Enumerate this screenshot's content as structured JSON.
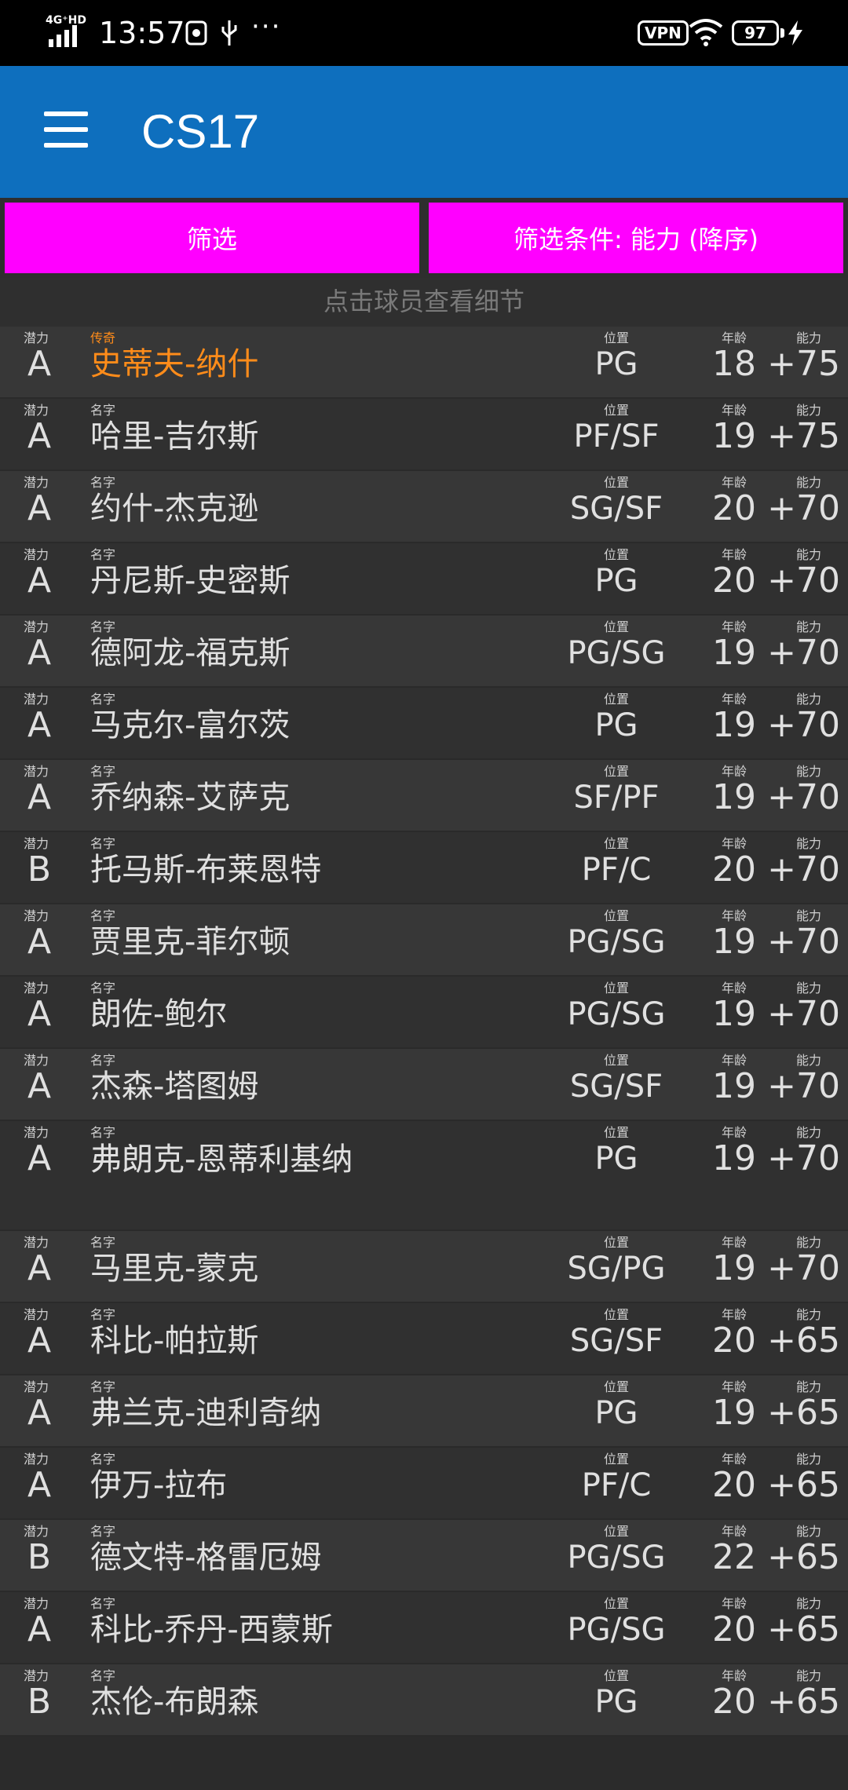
{
  "status_bar": {
    "network": "4G⁺HD",
    "time": "13:57",
    "more": "···",
    "vpn": "VPN",
    "battery": "97"
  },
  "app_bar": {
    "title": "CS17"
  },
  "filters": {
    "filter_label": "筛选",
    "sort_label": "筛选条件: 能力 (降序)"
  },
  "hint": "点击球员查看细节",
  "labels": {
    "potential": "潜力",
    "name": "名字",
    "legend_name": "传奇",
    "position": "位置",
    "age": "年龄",
    "ability": "能力"
  },
  "players": [
    {
      "potential": "A",
      "name": "史蒂夫-纳什",
      "position": "PG",
      "age": "18",
      "ability": "+75",
      "legend": true
    },
    {
      "potential": "A",
      "name": "哈里-吉尔斯",
      "position": "PF/SF",
      "age": "19",
      "ability": "+75"
    },
    {
      "potential": "A",
      "name": "约什-杰克逊",
      "position": "SG/SF",
      "age": "20",
      "ability": "+70"
    },
    {
      "potential": "A",
      "name": "丹尼斯-史密斯",
      "position": "PG",
      "age": "20",
      "ability": "+70"
    },
    {
      "potential": "A",
      "name": "德阿龙-福克斯",
      "position": "PG/SG",
      "age": "19",
      "ability": "+70"
    },
    {
      "potential": "A",
      "name": "马克尔-富尔茨",
      "position": "PG",
      "age": "19",
      "ability": "+70"
    },
    {
      "potential": "A",
      "name": "乔纳森-艾萨克",
      "position": "SF/PF",
      "age": "19",
      "ability": "+70"
    },
    {
      "potential": "B",
      "name": "托马斯-布莱恩特",
      "position": "PF/C",
      "age": "20",
      "ability": "+70"
    },
    {
      "potential": "A",
      "name": "贾里克-菲尔顿",
      "position": "PG/SG",
      "age": "19",
      "ability": "+70"
    },
    {
      "potential": "A",
      "name": "朗佐-鲍尔",
      "position": "PG/SG",
      "age": "19",
      "ability": "+70"
    },
    {
      "potential": "A",
      "name": "杰森-塔图姆",
      "position": "SG/SF",
      "age": "19",
      "ability": "+70"
    },
    {
      "potential": "A",
      "name": "弗朗克-恩蒂利基纳",
      "position": "PG",
      "age": "19",
      "ability": "+70",
      "tall": true
    },
    {
      "potential": "A",
      "name": "马里克-蒙克",
      "position": "SG/PG",
      "age": "19",
      "ability": "+70"
    },
    {
      "potential": "A",
      "name": "科比-帕拉斯",
      "position": "SG/SF",
      "age": "20",
      "ability": "+65"
    },
    {
      "potential": "A",
      "name": "弗兰克-迪利奇纳",
      "position": "PG",
      "age": "19",
      "ability": "+65"
    },
    {
      "potential": "A",
      "name": "伊万-拉布",
      "position": "PF/C",
      "age": "20",
      "ability": "+65"
    },
    {
      "potential": "B",
      "name": "德文特-格雷厄姆",
      "position": "PG/SG",
      "age": "22",
      "ability": "+65"
    },
    {
      "potential": "A",
      "name": "科比-乔丹-西蒙斯",
      "position": "PG/SG",
      "age": "20",
      "ability": "+65"
    },
    {
      "potential": "B",
      "name": "杰伦-布朗森",
      "position": "PG",
      "age": "20",
      "ability": "+65"
    }
  ]
}
